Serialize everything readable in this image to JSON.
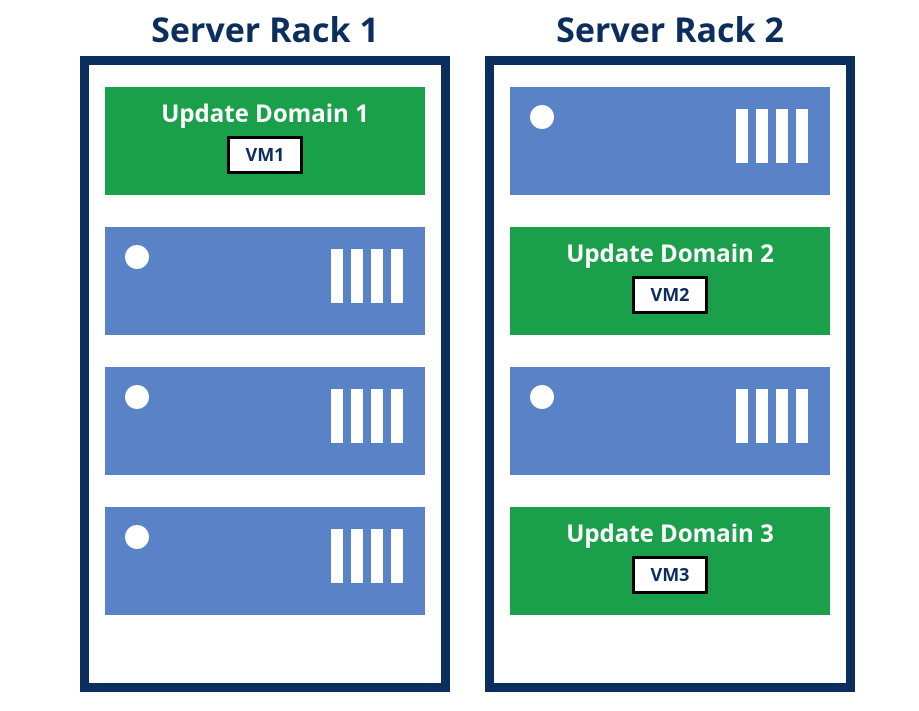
{
  "racks": [
    {
      "title": "Server Rack 1",
      "slots": [
        {
          "type": "domain",
          "domain_label": "Update Domain 1",
          "vm_label": "VM1"
        },
        {
          "type": "server"
        },
        {
          "type": "server"
        },
        {
          "type": "server"
        }
      ]
    },
    {
      "title": "Server Rack 2",
      "slots": [
        {
          "type": "server"
        },
        {
          "type": "domain",
          "domain_label": "Update Domain 2",
          "vm_label": "VM2"
        },
        {
          "type": "server"
        },
        {
          "type": "domain",
          "domain_label": "Update Domain 3",
          "vm_label": "VM3"
        }
      ]
    }
  ],
  "colors": {
    "rack_border": "#0b2e5c",
    "server_fill": "#5a82c6",
    "domain_fill": "#1aa04a"
  }
}
